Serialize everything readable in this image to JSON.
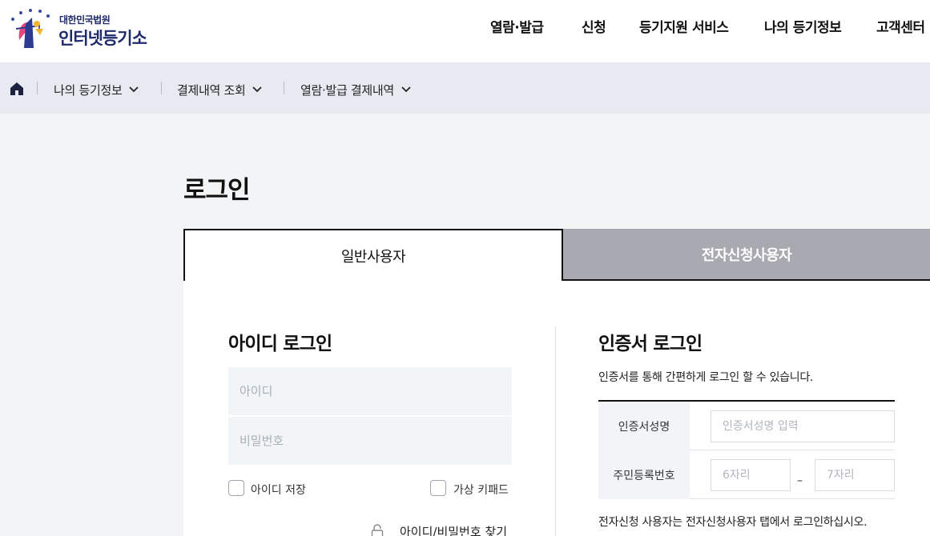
{
  "header": {
    "logo_sub": "대한민국법원",
    "logo_main": "인터넷등기소",
    "nav": [
      "열람·발급",
      "신청",
      "등기지원 서비스",
      "나의 등기정보",
      "고객센터"
    ]
  },
  "breadcrumb": {
    "items": [
      "나의 등기정보",
      "결제내역 조회",
      "열람·발급 결제내역"
    ]
  },
  "page": {
    "title": "로그인"
  },
  "tabs": {
    "general": "일반사용자",
    "electronic": "전자신청사용자"
  },
  "id_login": {
    "title": "아이디 로그인",
    "id_placeholder": "아이디",
    "pw_placeholder": "비밀번호",
    "save_id_label": "아이디 저장",
    "virtual_keypad_label": "가상 키패드",
    "find_label": "아이디/비밀번호 찾기"
  },
  "cert_login": {
    "title": "인증서 로그인",
    "description": "인증서를 통해 간편하게 로그인 할 수 있습니다.",
    "name_label": "인증서성명",
    "name_placeholder": "인증서성명 입력",
    "rrn_label": "주민등록번호",
    "rrn_front_placeholder": "6자리",
    "rrn_dash": "–",
    "rrn_back_placeholder": "7자리",
    "note": "전자신청 사용자는 전자신청사용자 탭에서 로그인하십시오."
  },
  "colors": {
    "brand_navy": "#1f2a6b",
    "tab_inactive": "#a8a9b1",
    "breadcrumb_bg": "#e8eaf2"
  }
}
